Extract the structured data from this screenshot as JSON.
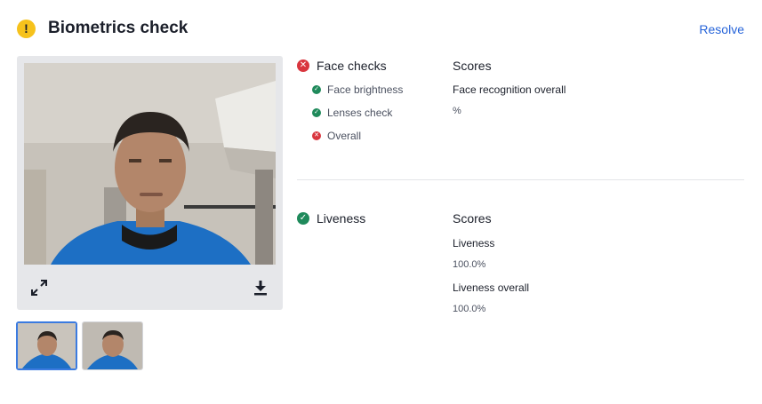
{
  "header": {
    "title": "Biometrics check",
    "action_label": "Resolve",
    "status_icon": "warning-icon",
    "status_color": "#f6c21c",
    "link_color": "#2563d9"
  },
  "media": {
    "expand_icon": "expand-icon",
    "download_icon": "download-icon",
    "thumbnails_count_visible": 2,
    "selected_thumbnail": 1
  },
  "face_checks": {
    "title": "Face checks",
    "status": "fail",
    "items": [
      {
        "label": "Face brightness",
        "status": "pass"
      },
      {
        "label": "Lenses check",
        "status": "pass"
      },
      {
        "label": "Overall",
        "status": "fail"
      }
    ],
    "scores_title": "Scores",
    "scores": [
      {
        "label": "Face recognition overall",
        "value": "%"
      }
    ]
  },
  "liveness": {
    "title": "Liveness",
    "status": "pass",
    "scores_title": "Scores",
    "scores": [
      {
        "label": "Liveness",
        "value": "100.0%"
      },
      {
        "label": "Liveness overall",
        "value": "100.0%"
      }
    ]
  },
  "colors": {
    "fail": "#d9363e",
    "pass": "#1f8a5b",
    "selected_border": "#3b7be0"
  }
}
